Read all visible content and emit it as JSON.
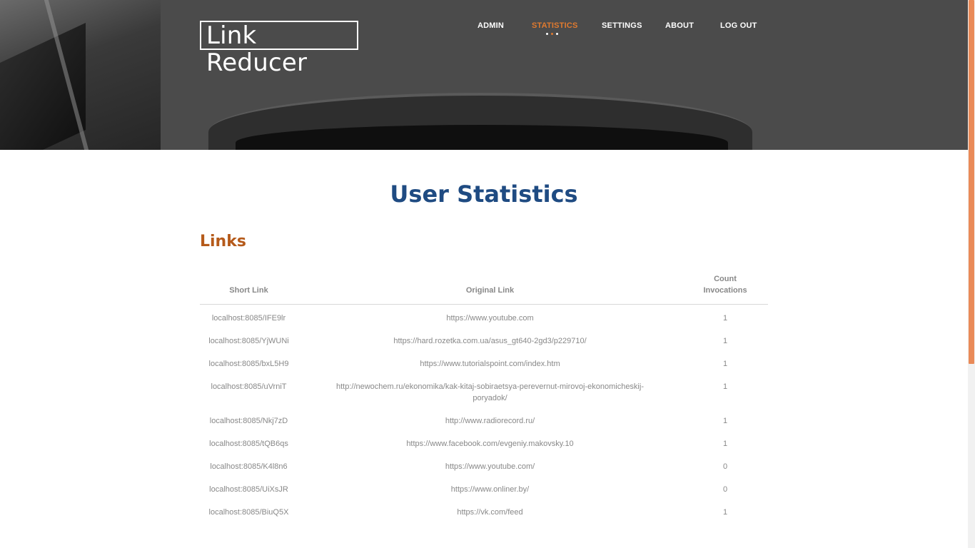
{
  "header": {
    "logo": "Link Reducer",
    "nav": [
      {
        "label": "ADMIN",
        "active": false
      },
      {
        "label": "STATISTICS",
        "active": true
      },
      {
        "label": "SETTINGS",
        "active": false
      },
      {
        "label": "ABOUT",
        "active": false
      },
      {
        "label": "LOG OUT",
        "active": false
      }
    ]
  },
  "main": {
    "title": "User Statistics",
    "section_title": "Links",
    "table": {
      "columns": [
        "Short Link",
        "Original Link",
        "Count Invocations"
      ],
      "rows": [
        {
          "short": "localhost:8085/IFE9lr",
          "original": "https://www.youtube.com",
          "count": "1"
        },
        {
          "short": "localhost:8085/YjWUNi",
          "original": "https://hard.rozetka.com.ua/asus_gt640-2gd3/p229710/",
          "count": "1"
        },
        {
          "short": "localhost:8085/bxL5H9",
          "original": "https://www.tutorialspoint.com/index.htm",
          "count": "1"
        },
        {
          "short": "localhost:8085/uVrniT",
          "original": "http://newochem.ru/ekonomika/kak-kitaj-sobiraetsya-perevernut-mirovoj-ekonomicheskij-poryadok/",
          "count": "1"
        },
        {
          "short": "localhost:8085/Nkj7zD",
          "original": "http://www.radiorecord.ru/",
          "count": "1"
        },
        {
          "short": "localhost:8085/tQB6qs",
          "original": "https://www.facebook.com/evgeniy.makovsky.10",
          "count": "1"
        },
        {
          "short": "localhost:8085/K4l8n6",
          "original": "https://www.youtube.com/",
          "count": "0"
        },
        {
          "short": "localhost:8085/UiXsJR",
          "original": "https://www.onliner.by/",
          "count": "0"
        },
        {
          "short": "localhost:8085/BiuQ5X",
          "original": "https://vk.com/feed",
          "count": "1"
        }
      ]
    }
  },
  "colors": {
    "accent": "#e07a2f",
    "title": "#1f4b82",
    "section": "#b55a1a",
    "scroll_thumb": "#e98a58"
  }
}
